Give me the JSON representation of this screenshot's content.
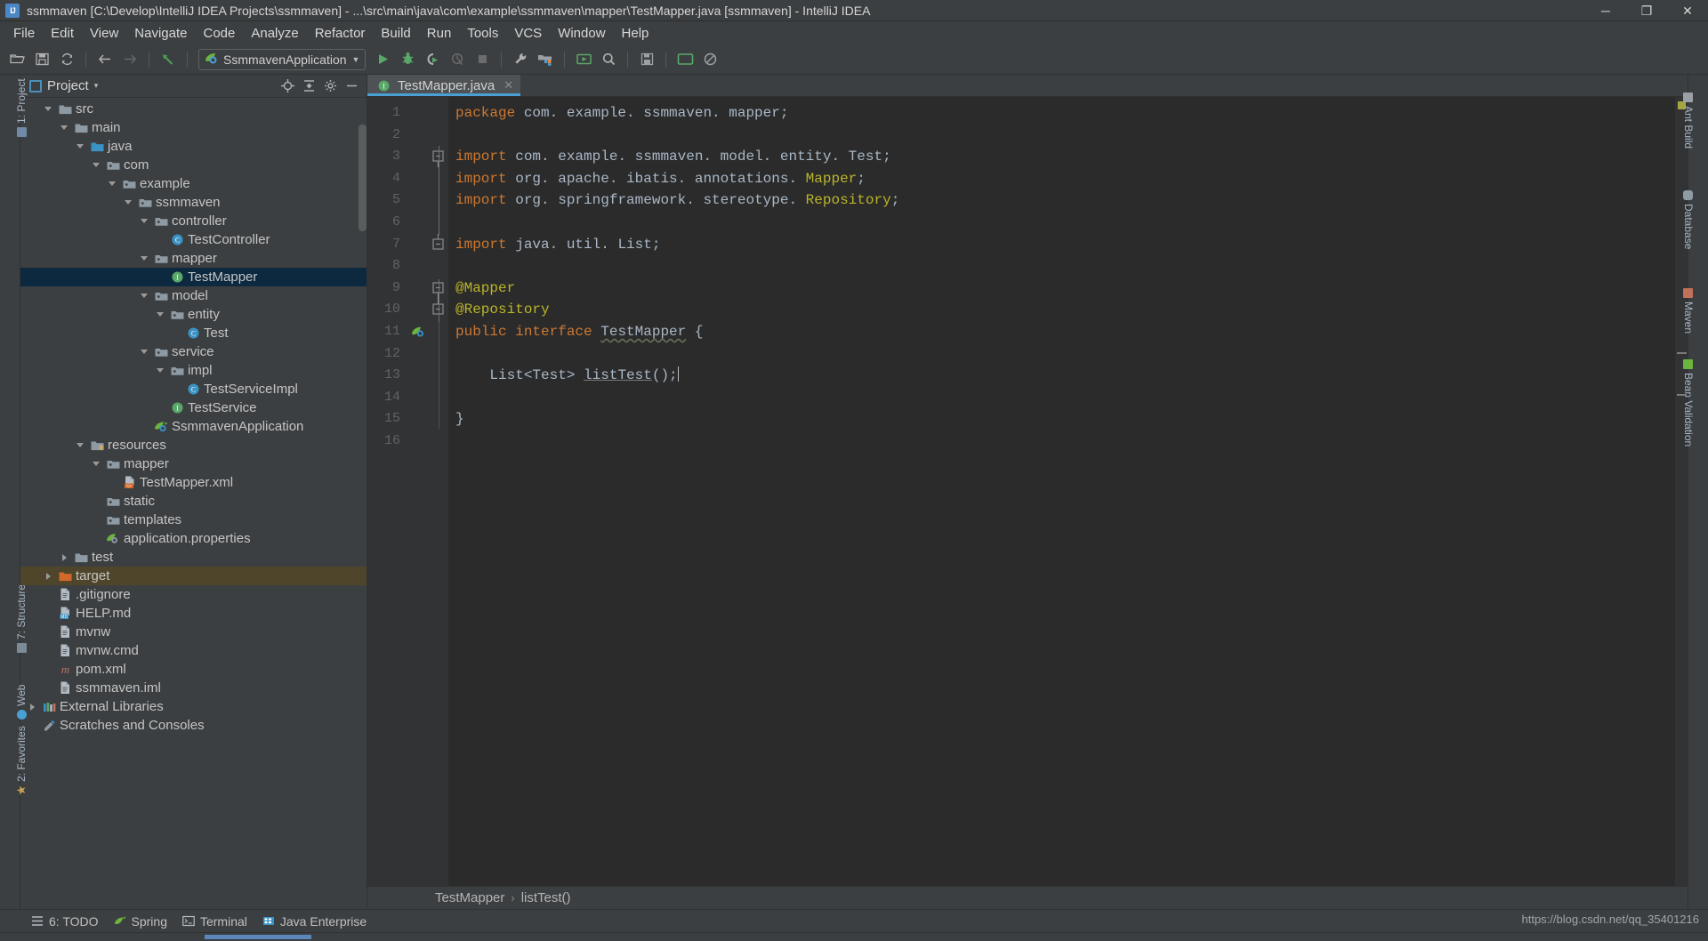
{
  "window": {
    "title": "ssmmaven [C:\\Develop\\IntelliJ IDEA Projects\\ssmmaven] - ...\\src\\main\\java\\com\\example\\ssmmaven\\mapper\\TestMapper.java [ssmmaven] - IntelliJ IDEA",
    "app_icon": "intellij-idea-icon",
    "controls": {
      "minimize": "─",
      "maximize": "❐",
      "close": "✕"
    }
  },
  "menubar": {
    "items": [
      "File",
      "Edit",
      "View",
      "Navigate",
      "Code",
      "Analyze",
      "Refactor",
      "Build",
      "Run",
      "Tools",
      "VCS",
      "Window",
      "Help"
    ]
  },
  "toolbar": {
    "icons": [
      "open-folder-icon",
      "save-all-icon",
      "sync-refresh-icon",
      "back-arrow-icon",
      "forward-arrow-icon",
      "undo-arrow-icon"
    ],
    "run_config": {
      "label": "SsmmavenApplication",
      "icon": "spring-boot-icon",
      "caret": "▼"
    },
    "run_icons": [
      "run-icon",
      "debug-icon",
      "run-with-coverage-icon",
      "profile-icon",
      "stop-icon",
      "settings-wrench-icon",
      "project-structure-icon",
      "update-app-icon",
      "search-everywhere-icon",
      "save-icon",
      "terminal-icon",
      "help-circle-icon"
    ]
  },
  "left_rail": {
    "top": "1: Project",
    "items": [
      "7: Structure",
      "Web",
      "2: Favorites"
    ]
  },
  "right_rail": {
    "items": [
      "Ant Build",
      "Database",
      "Maven",
      "Bean Validation"
    ]
  },
  "project_panel": {
    "header": {
      "title": "Project",
      "caret": "▾",
      "icons": [
        "locate-target-icon",
        "collapse-all-icon",
        "settings-gear-icon",
        "hide-minimize-icon"
      ]
    },
    "tree": [
      {
        "label": "src",
        "depth": 1,
        "twisty": "open",
        "icon": "folder-icon"
      },
      {
        "label": "main",
        "depth": 2,
        "twisty": "open",
        "icon": "folder-icon"
      },
      {
        "label": "java",
        "depth": 3,
        "twisty": "open",
        "icon": "source-root-folder-icon"
      },
      {
        "label": "com",
        "depth": 4,
        "twisty": "open",
        "icon": "package-icon"
      },
      {
        "label": "example",
        "depth": 5,
        "twisty": "open",
        "icon": "package-icon"
      },
      {
        "label": "ssmmaven",
        "depth": 6,
        "twisty": "open",
        "icon": "package-icon"
      },
      {
        "label": "controller",
        "depth": 7,
        "twisty": "open",
        "icon": "package-icon"
      },
      {
        "label": "TestController",
        "depth": 8,
        "twisty": "none",
        "icon": "java-class-icon"
      },
      {
        "label": "mapper",
        "depth": 7,
        "twisty": "open",
        "icon": "package-icon"
      },
      {
        "label": "TestMapper",
        "depth": 8,
        "twisty": "none",
        "icon": "java-interface-icon",
        "state": "selected"
      },
      {
        "label": "model",
        "depth": 7,
        "twisty": "open",
        "icon": "package-icon"
      },
      {
        "label": "entity",
        "depth": 8,
        "twisty": "open",
        "icon": "package-icon"
      },
      {
        "label": "Test",
        "depth": 9,
        "twisty": "none",
        "icon": "java-class-icon"
      },
      {
        "label": "service",
        "depth": 7,
        "twisty": "open",
        "icon": "package-icon"
      },
      {
        "label": "impl",
        "depth": 8,
        "twisty": "open",
        "icon": "package-icon"
      },
      {
        "label": "TestServiceImpl",
        "depth": 9,
        "twisty": "none",
        "icon": "java-class-icon"
      },
      {
        "label": "TestService",
        "depth": 8,
        "twisty": "none",
        "icon": "java-interface-icon"
      },
      {
        "label": "SsmmavenApplication",
        "depth": 7,
        "twisty": "none",
        "icon": "spring-boot-class-icon"
      },
      {
        "label": "resources",
        "depth": 3,
        "twisty": "open",
        "icon": "resource-root-folder-icon"
      },
      {
        "label": "mapper",
        "depth": 4,
        "twisty": "open",
        "icon": "package-icon"
      },
      {
        "label": "TestMapper.xml",
        "depth": 5,
        "twisty": "none",
        "icon": "xml-file-icon"
      },
      {
        "label": "static",
        "depth": 4,
        "twisty": "none",
        "icon": "package-icon"
      },
      {
        "label": "templates",
        "depth": 4,
        "twisty": "none",
        "icon": "package-icon"
      },
      {
        "label": "application.properties",
        "depth": 4,
        "twisty": "none",
        "icon": "spring-properties-icon"
      },
      {
        "label": "test",
        "depth": 2,
        "twisty": "closed",
        "icon": "folder-icon"
      },
      {
        "label": "target",
        "depth": 1,
        "twisty": "closed",
        "icon": "excluded-folder-icon",
        "state": "highlighted"
      },
      {
        "label": ".gitignore",
        "depth": 1,
        "twisty": "none",
        "icon": "text-file-icon"
      },
      {
        "label": "HELP.md",
        "depth": 1,
        "twisty": "none",
        "icon": "markdown-file-icon"
      },
      {
        "label": "mvnw",
        "depth": 1,
        "twisty": "none",
        "icon": "text-file-icon"
      },
      {
        "label": "mvnw.cmd",
        "depth": 1,
        "twisty": "none",
        "icon": "text-file-icon"
      },
      {
        "label": "pom.xml",
        "depth": 1,
        "twisty": "none",
        "icon": "maven-pom-icon"
      },
      {
        "label": "ssmmaven.iml",
        "depth": 1,
        "twisty": "none",
        "icon": "module-iml-icon"
      },
      {
        "label": "External Libraries",
        "depth": 0,
        "twisty": "closed",
        "icon": "libraries-icon"
      },
      {
        "label": "Scratches and Consoles",
        "depth": 0,
        "twisty": "none",
        "icon": "scratches-icon"
      }
    ]
  },
  "editor": {
    "tabs": [
      {
        "label": "TestMapper.java",
        "icon": "java-interface-icon",
        "close": "✕",
        "active": true
      }
    ],
    "lines": [
      {
        "n": "1",
        "fold": "none",
        "gutter": "",
        "tokens": [
          {
            "t": "package ",
            "c": "kw"
          },
          {
            "t": "com. example. ssmmaven. mapper;",
            "c": "ident"
          }
        ]
      },
      {
        "n": "2",
        "fold": "none",
        "gutter": "",
        "tokens": []
      },
      {
        "n": "3",
        "fold": "start",
        "gutter": "",
        "tokens": [
          {
            "t": "import ",
            "c": "kw"
          },
          {
            "t": "com. example. ssmmaven. model. entity. Test;",
            "c": "ident"
          }
        ]
      },
      {
        "n": "4",
        "fold": "none",
        "gutter": "",
        "tokens": [
          {
            "t": "import ",
            "c": "kw"
          },
          {
            "t": "org. apache. ibatis. annotations. ",
            "c": "ident"
          },
          {
            "t": "Mapper",
            "c": "an"
          },
          {
            "t": ";",
            "c": "ident"
          }
        ]
      },
      {
        "n": "5",
        "fold": "none",
        "gutter": "",
        "tokens": [
          {
            "t": "import ",
            "c": "kw"
          },
          {
            "t": "org. springframework. stereotype. ",
            "c": "ident"
          },
          {
            "t": "Repository",
            "c": "an"
          },
          {
            "t": ";",
            "c": "ident"
          }
        ]
      },
      {
        "n": "6",
        "fold": "none",
        "gutter": "",
        "tokens": []
      },
      {
        "n": "7",
        "fold": "end",
        "gutter": "",
        "tokens": [
          {
            "t": "import ",
            "c": "kw"
          },
          {
            "t": "java. util. List;",
            "c": "ident"
          }
        ]
      },
      {
        "n": "8",
        "fold": "none",
        "gutter": "",
        "tokens": []
      },
      {
        "n": "9",
        "fold": "start",
        "gutter": "",
        "tokens": [
          {
            "t": "@Mapper",
            "c": "an"
          }
        ]
      },
      {
        "n": "10",
        "fold": "end",
        "gutter": "",
        "tokens": [
          {
            "t": "@Repository",
            "c": "an"
          }
        ]
      },
      {
        "n": "11",
        "fold": "none",
        "gutter": "spring-bean-icon",
        "tokens": [
          {
            "t": "public ",
            "c": "kw"
          },
          {
            "t": "interface ",
            "c": "kw"
          },
          {
            "t": "TestMapper",
            "c": "wav"
          },
          {
            "t": " {",
            "c": "ident"
          }
        ]
      },
      {
        "n": "12",
        "fold": "none",
        "gutter": "",
        "tokens": []
      },
      {
        "n": "13",
        "fold": "none",
        "gutter": "",
        "tokens": [
          {
            "t": "    List<Test> ",
            "c": "ident"
          },
          {
            "t": "listTest",
            "c": "met"
          },
          {
            "t": "();",
            "c": "ident"
          }
        ],
        "caret": true
      },
      {
        "n": "14",
        "fold": "none",
        "gutter": "",
        "tokens": []
      },
      {
        "n": "15",
        "fold": "none",
        "gutter": "",
        "tokens": [
          {
            "t": "}",
            "c": "ident"
          }
        ]
      },
      {
        "n": "16",
        "fold": "none",
        "gutter": "",
        "tokens": []
      }
    ],
    "breadcrumb": {
      "parts": [
        "TestMapper",
        "listTest()"
      ],
      "separator": "›"
    }
  },
  "bottom_bar": {
    "items": [
      {
        "label": "6: TODO",
        "icon": "todo-icon"
      },
      {
        "label": "Spring",
        "icon": "spring-leaf-icon"
      },
      {
        "label": "Terminal",
        "icon": "terminal-icon"
      },
      {
        "label": "Java Enterprise",
        "icon": "java-enterprise-icon"
      }
    ]
  },
  "watermark": {
    "text": "https://blog.csdn.net/qq_35401216"
  },
  "colors": {
    "accent": "#4a9fd4",
    "selection": "#0d293f",
    "excluded": "#4e452b",
    "keyword": "#cc7832",
    "annotation": "#bbb529",
    "editor_bg": "#2b2b2b",
    "panel_bg": "#3c3f41",
    "gutter_bg": "#313335"
  }
}
